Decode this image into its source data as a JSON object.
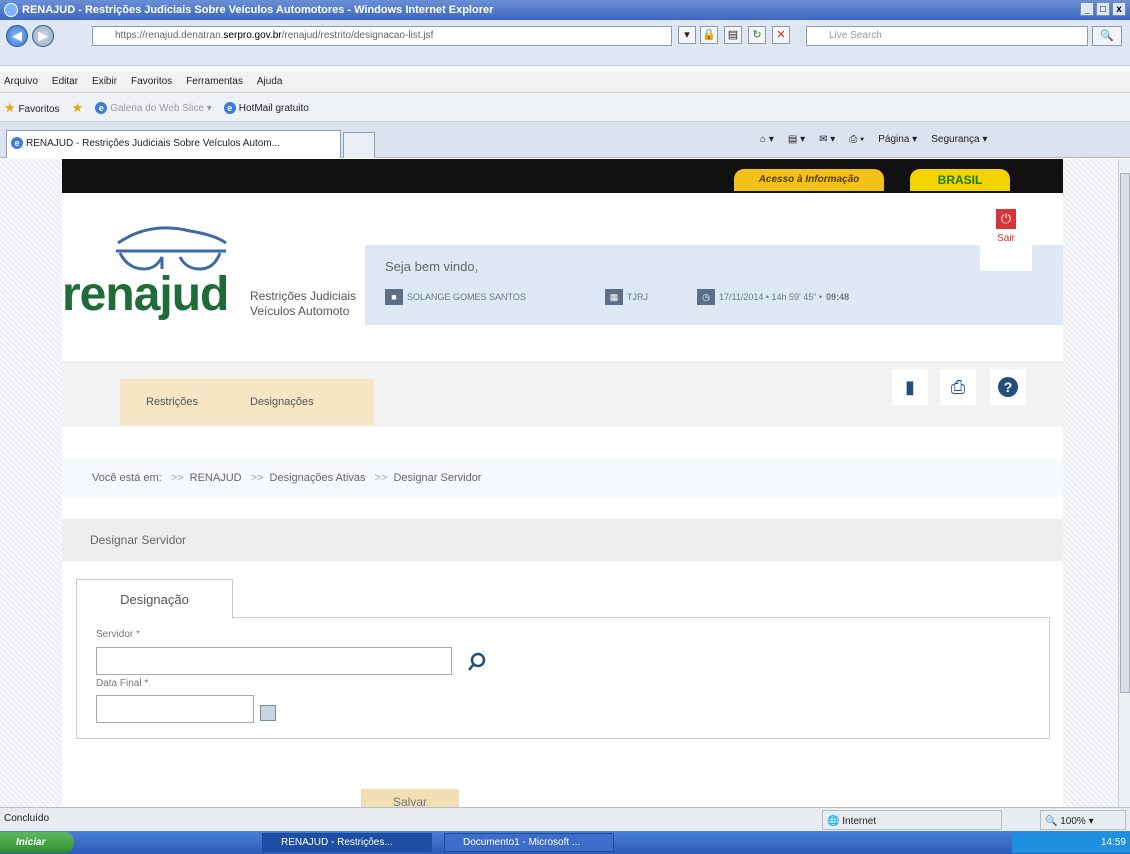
{
  "window": {
    "title": "RENAJUD - Restrições Judiciais Sobre Veículos Automotores - Windows Internet Explorer",
    "controls": [
      "_",
      "□",
      "x"
    ]
  },
  "addressbar": {
    "url_prefix": "https://renajud.denatran.",
    "url_host": "serpro.gov.br",
    "url_path": "/renajud/restrito/designacao-list.jsf",
    "search_placeholder": "Live Search"
  },
  "menubar": [
    "Arquivo",
    "Editar",
    "Exibir",
    "Favoritos",
    "Ferramentas",
    "Ajuda"
  ],
  "favoritesbar": {
    "favorites": "Favoritos",
    "webslice": "Galeria do Web Slice",
    "hotmail": "HotMail gratuito"
  },
  "tabs": {
    "active_title": "RENAJUD - Restrições Judiciais Sobre Veículos Autom...",
    "commands": [
      "Página",
      "Segurança"
    ]
  },
  "gov": {
    "acesso": "Acesso à Informação",
    "brasil": "BRASIL"
  },
  "logo": {
    "name": "renajud",
    "subtitle_1": "Restrições Judiciais",
    "subtitle_2": "Veículos Automoto"
  },
  "welcome": {
    "title": "Seja bem vindo,",
    "user": "SOLANGE GOMES SANTOS",
    "org": "TJRJ",
    "datetime": "17/11/2014 • 14h 59' 45\" •",
    "timer": "09:48",
    "logout": "Sair"
  },
  "nav": {
    "restricoes": "Restrições",
    "designacoes": "Designações"
  },
  "breadcrumb": {
    "prefix": "Você está em:",
    "items": [
      "RENAJUD",
      "Designações Ativas",
      "Designar Servidor"
    ]
  },
  "section_title": "Designar Servidor",
  "form": {
    "tab": "Designação",
    "servidor_label": "Servidor *",
    "servidor_value": "",
    "data_label": "Data Final *",
    "data_value": "",
    "save": "Salvar"
  },
  "statusbar": {
    "status": "Concluído",
    "zone": "Internet",
    "zoom": "100%"
  },
  "taskbar": {
    "start": "Iniciar",
    "task1": "RENAJUD - Restrições...",
    "task2": "Documento1 - Microsoft ...",
    "clock": "14:59"
  }
}
